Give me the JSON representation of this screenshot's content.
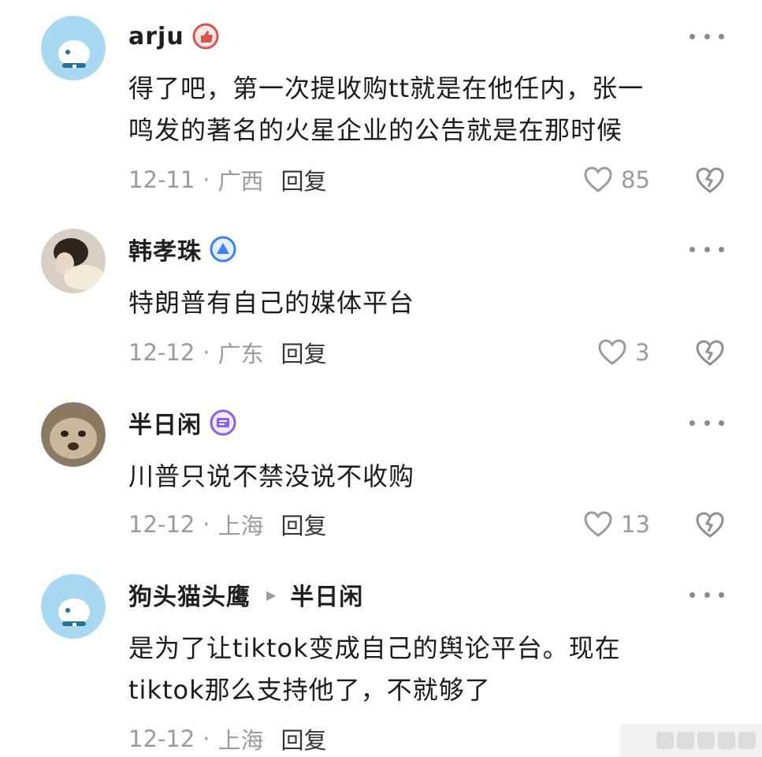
{
  "comments": [
    {
      "username": "arju",
      "badge": "thumbs-up-badge-icon",
      "text_lines": [
        "得了吧，第一次提收购tt就是在他任内，张一",
        "鸣发的著名的火星企业的公告就是在那时候"
      ],
      "date": "12-11",
      "location": "广西",
      "reply_label": "回复",
      "likes": "85"
    },
    {
      "username": "韩孝珠",
      "badge": "blue-triangle-badge-icon",
      "text_lines": [
        "特朗普有自己的媒体平台"
      ],
      "date": "12-12",
      "location": "广东",
      "reply_label": "回复",
      "likes": "3"
    },
    {
      "username": "半日闲",
      "badge": "purple-tv-badge-icon",
      "text_lines": [
        "川普只说不禁没说不收购"
      ],
      "date": "12-12",
      "location": "上海",
      "reply_label": "回复",
      "likes": "13"
    },
    {
      "username": "狗头猫头鹰",
      "reply_to": "半日闲",
      "text_lines": [
        "是为了让tiktok变成自己的舆论平台。现在",
        "tiktok那么支持他了，不就够了"
      ],
      "date": "12-12",
      "location": "上海",
      "reply_label": "回复",
      "likes": ""
    }
  ],
  "separator": "·",
  "colors": {
    "meta": "#9b9b9b",
    "badge_red": "#d9534f",
    "badge_blue": "#3b82f6",
    "badge_purple": "#8b5cf6"
  }
}
